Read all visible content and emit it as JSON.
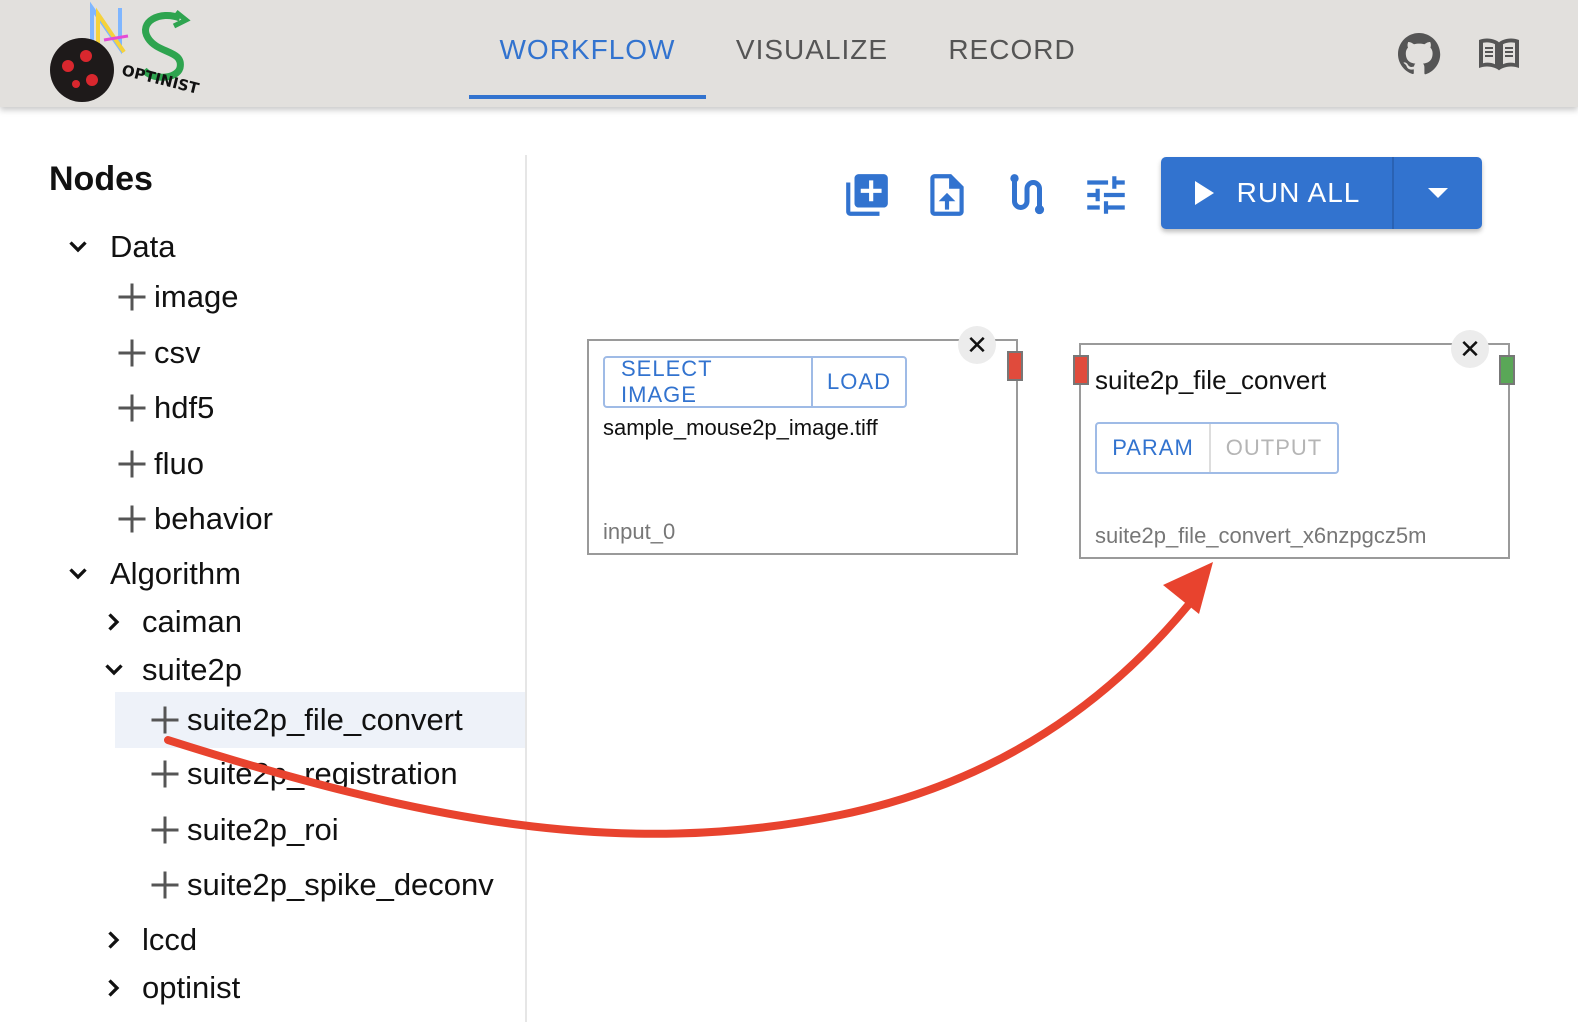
{
  "app": {
    "logo_text": "OPTINIST",
    "tabs": [
      {
        "label": "WORKFLOW",
        "active": true
      },
      {
        "label": "VISUALIZE",
        "active": false
      },
      {
        "label": "RECORD",
        "active": false
      }
    ],
    "icons": [
      "github-icon",
      "docs-book-icon"
    ],
    "accent_color": "#3273cf"
  },
  "sidebar": {
    "title": "Nodes",
    "tree": {
      "data": {
        "label": "Data",
        "expanded": true,
        "items": [
          "image",
          "csv",
          "hdf5",
          "fluo",
          "behavior"
        ]
      },
      "algorithm": {
        "label": "Algorithm",
        "expanded": true,
        "groups": [
          {
            "label": "caiman",
            "expanded": false
          },
          {
            "label": "suite2p",
            "expanded": true,
            "items": [
              "suite2p_file_convert",
              "suite2p_registration",
              "suite2p_roi",
              "suite2p_spike_deconv"
            ],
            "selected": "suite2p_file_convert"
          },
          {
            "label": "lccd",
            "expanded": false
          },
          {
            "label": "optinist",
            "expanded": false
          }
        ]
      }
    }
  },
  "toolbar": {
    "icons": [
      "add-node-icon",
      "upload-file-icon",
      "route-icon",
      "tune-icon"
    ],
    "run_all_label": "RUN ALL"
  },
  "canvas": {
    "nodes": [
      {
        "id_label": "input_0",
        "buttons": [
          "SELECT IMAGE",
          "LOAD"
        ],
        "file_name": "sample_mouse2p_image.tiff",
        "output_handle_color": "#e04b3c"
      },
      {
        "title": "suite2p_file_convert",
        "buttons": [
          "PARAM",
          "OUTPUT"
        ],
        "output_disabled": true,
        "id_label": "suite2p_file_convert_x6nzpgcz5m",
        "input_handle_color": "#e04b3c",
        "output_handle_color": "#5aa757"
      }
    ],
    "close_symbol": "✕",
    "annotation": "red-drag-arrow-icon"
  }
}
